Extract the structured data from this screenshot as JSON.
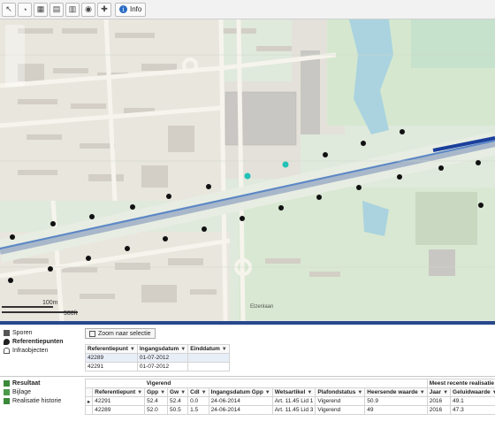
{
  "toolbar": {
    "buttons": [
      {
        "name": "pointer-tool-icon",
        "glyph": "↖"
      },
      {
        "name": "select-tool-icon",
        "glyph": "◔"
      },
      {
        "name": "layers-icon",
        "glyph": "▦"
      },
      {
        "name": "table-icon",
        "glyph": "▤"
      },
      {
        "name": "grid-icon",
        "glyph": "▥"
      },
      {
        "name": "legend-icon",
        "glyph": "◉"
      },
      {
        "name": "measure-icon",
        "glyph": "✚"
      }
    ],
    "info_label": "Info"
  },
  "map": {
    "scale_small": "100m",
    "scale_large": "500ft",
    "street_label": "Elzenlaan",
    "colors": {
      "base": "#dfe9dc",
      "road": "#f6f4ec",
      "water": "#aad3df",
      "building": "#c9c7c3",
      "rail": "#5b87c6"
    },
    "markers": "black dots = referentiepunten, teal dots = selected points"
  },
  "nav": {
    "top": [
      {
        "label": "Sporen",
        "icon": "train-icon"
      },
      {
        "label": "Referentiepunten",
        "icon": "pin-icon",
        "active": true
      },
      {
        "label": "Infraobjecten",
        "icon": "object-icon"
      }
    ],
    "bottom": [
      {
        "label": "Resultaat",
        "icon": "result-icon",
        "active": true
      },
      {
        "label": "Bijlage",
        "icon": "attachment-icon"
      },
      {
        "label": "Realisatie historie",
        "icon": "history-icon"
      }
    ]
  },
  "selection": {
    "zoom_label": "Zoom naar selectie"
  },
  "ref_table": {
    "headers": [
      "Referentiepunt",
      "Ingangsdatum",
      "Einddatum"
    ],
    "rows": [
      [
        "42289",
        "01-07-2012",
        ""
      ],
      [
        "42291",
        "01-07-2012",
        ""
      ]
    ]
  },
  "result_table": {
    "group_headers": {
      "vigerend": "Vigerend",
      "meest": "Meest recente realisatie"
    },
    "headers": [
      "Referentiepunt",
      "Gpp",
      "Gw",
      "Cdl",
      "Ingangsdatum Gpp",
      "Wetsartikel",
      "Plafondstatus",
      "Heersende waarde",
      "Jaar",
      "Geluidwaarde"
    ],
    "rows": [
      [
        "42291",
        "52.4",
        "52.4",
        "0.0",
        "24-06-2014",
        "Art. 11.45 Lid 1",
        "Vigerend",
        "50.9",
        "2016",
        "49.1"
      ],
      [
        "42289",
        "52.0",
        "50.5",
        "1.5",
        "24-06-2014",
        "Art. 11.45 Lid 3",
        "Vigerend",
        "49",
        "2016",
        "47.3"
      ]
    ]
  }
}
